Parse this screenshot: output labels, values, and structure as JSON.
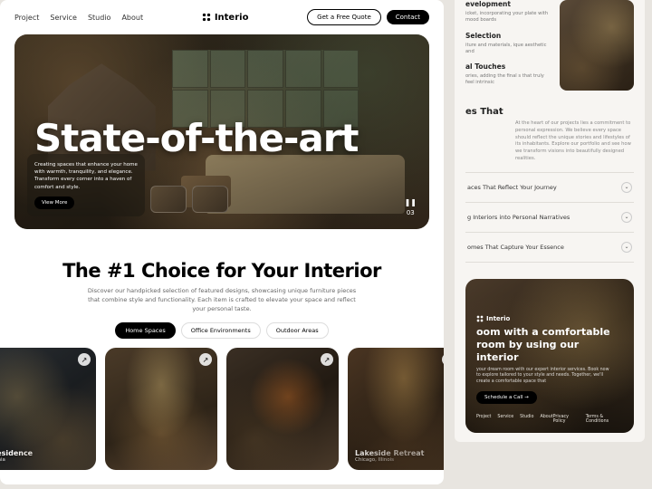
{
  "nav": {
    "links": [
      "Project",
      "Service",
      "Studio",
      "About"
    ],
    "brand": "Interio",
    "quote_btn": "Get a Free Quote",
    "contact_btn": "Contact"
  },
  "hero": {
    "title": "State-of-the-art",
    "caption": "Creating spaces that enhance your home with warmth, tranquility, and elegance. Transform every corner into a haven of comfort and style.",
    "view_more": "View More",
    "counter": "03",
    "pause_icon": "❚❚"
  },
  "section": {
    "heading": "The #1 Choice for Your Interior",
    "sub": "Discover our handpicked selection of featured designs, showcasing unique furniture pieces that combine style and functionality. Each item is crafted to elevate your space and reflect your personal taste.",
    "tabs": [
      "Home Spaces",
      "Office Environments",
      "Outdoor Areas"
    ],
    "active_tab": 0
  },
  "gallery": [
    {
      "title": "Residence",
      "location": "fornia"
    },
    {
      "title": "",
      "location": ""
    },
    {
      "title": "",
      "location": ""
    },
    {
      "title": "Lakeside Retreat",
      "location": "Chicago, Illinois"
    }
  ],
  "right": {
    "list": [
      {
        "h": "evelopment",
        "p": "icket, incorporating your plate with mood boards"
      },
      {
        "h": "Selection",
        "p": "iture and materials, ique aesthetic and"
      },
      {
        "h": "al Touches",
        "p": "ories, adding the final s that truly feel intrinsic"
      }
    ],
    "heading": "es That",
    "desc": "At the heart of our projects lies a commitment to personal expression. We believe every space should reflect the unique stories and lifestyles of its inhabitants. Explore our portfolio and see how we transform visions into beautifully designed realities.",
    "accordion": [
      "aces That Reflect Your Journey",
      "g Interiors into Personal Narratives",
      "omes That Capture Your Essence"
    ]
  },
  "footer": {
    "brand": "Interio",
    "title": "oom with a comfortable room by using our interior",
    "desc": "your dream room with our expert interior services. Book now to explore tailored to your style and needs. Together, we'll create a comfortable space that",
    "cta": "Schedule a Call →",
    "nav_left": [
      "Project",
      "Service",
      "Studio",
      "About"
    ],
    "nav_right": [
      "Privacy Policy",
      "Terms & Conditions"
    ]
  }
}
